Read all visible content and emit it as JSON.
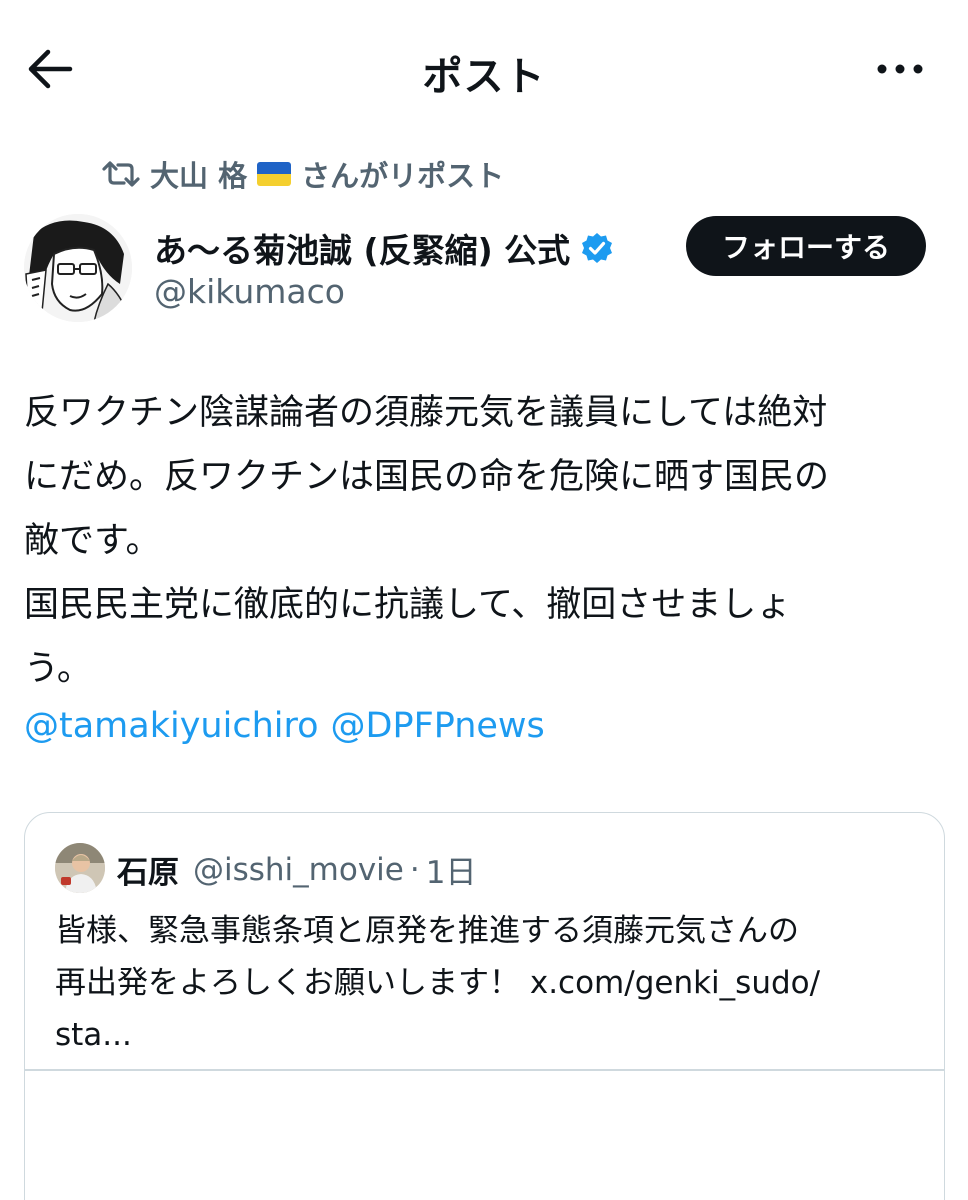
{
  "header": {
    "title": "ポスト",
    "back_icon": "arrow-left-icon",
    "more_icon": "more-horizontal-icon"
  },
  "repost": {
    "name": "大山 格",
    "suffix": "さんがリポスト",
    "icon": "repost-icon",
    "flag": "ukraine-flag"
  },
  "author": {
    "name": "あ〜る菊池誠 (反緊縮) 公式",
    "handle": "@kikumaco",
    "verified": true,
    "follow_label": "フォローする"
  },
  "post": {
    "lines": [
      "反ワクチン陰謀論者の須藤元気を議員にしては絶対",
      "にだめ。反ワクチンは国民の命を危険に晒す国民の",
      "敵です。",
      "国民民主党に徹底的に抗議して、撤回させましょ",
      "う。"
    ],
    "mentions": [
      "@tamakiyuichiro",
      "@DPFPnews"
    ]
  },
  "quote": {
    "name": "石原",
    "handle": "@isshi_movie",
    "separator": "·",
    "time": "1日",
    "lines": [
      "皆様、緊急事態条項と原発を推進する須藤元気さんの",
      "再出発をよろしくお願いします！ x.com/genki_sudo/",
      "sta..."
    ]
  },
  "colors": {
    "text": "#0f1419",
    "secondary": "#536471",
    "link": "#1d9bf0",
    "verified": "#1d9bf0",
    "border": "#cfd9de",
    "button_bg": "#0f1419"
  }
}
